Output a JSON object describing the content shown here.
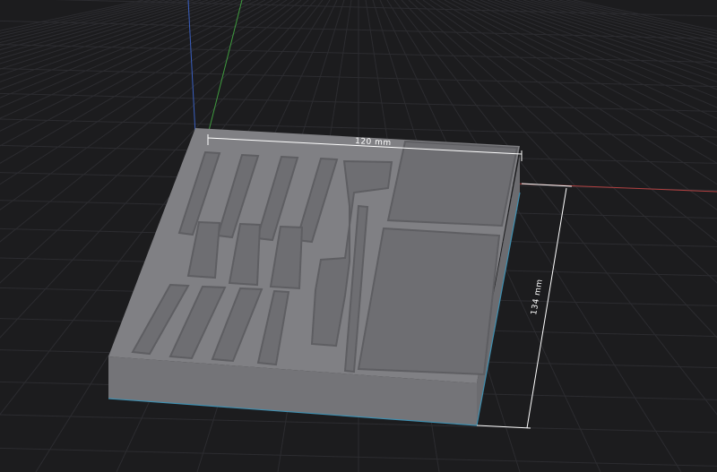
{
  "viewport": {
    "background_color": "#1c1c1e",
    "grid_color": "#2c2c30",
    "axis_x_color": "#b04040",
    "axis_y_color": "#3f9a3f",
    "axis_z_color": "#3a5fc0"
  },
  "model": {
    "top_color": "#808084",
    "wall_color": "#8a8a8e",
    "pocket_floor_color": "#6e6e72",
    "pocket_wall_color": "#5e5e62",
    "side_color": "#6c6c70",
    "front_color": "#747478",
    "edge_color": "#3f8fb0"
  },
  "dimensions": {
    "width_label": "120 mm",
    "depth_label": "134 mm",
    "line_color": "#ffffff"
  }
}
